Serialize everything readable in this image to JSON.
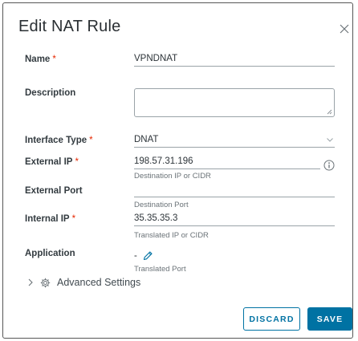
{
  "dialog": {
    "title": "Edit NAT Rule"
  },
  "form": {
    "required_marker": "*",
    "name": {
      "label": "Name",
      "value": "VPNDNAT"
    },
    "description": {
      "label": "Description",
      "value": ""
    },
    "interface_type": {
      "label": "Interface Type",
      "value": "DNAT"
    },
    "external_ip": {
      "label": "External IP",
      "value": "198.57.31.196",
      "hint": "Destination IP or CIDR"
    },
    "external_port": {
      "label": "External Port",
      "value": "",
      "hint": "Destination Port"
    },
    "internal_ip": {
      "label": "Internal IP",
      "value": "35.35.35.3",
      "hint": "Translated IP or CIDR"
    },
    "application": {
      "label": "Application",
      "value": "-",
      "hint": "Translated Port"
    }
  },
  "advanced": {
    "label": "Advanced Settings"
  },
  "actions": {
    "discard_label": "DISCARD",
    "save_label": "SAVE"
  },
  "colors": {
    "accent": "#0072a3",
    "required": "#e62700"
  },
  "icons": {
    "close": "close-icon",
    "dropdown": "chevron-down-icon",
    "info": "info-icon",
    "edit": "pencil-icon",
    "expand": "chevron-right-icon",
    "settings": "gear-icon"
  }
}
